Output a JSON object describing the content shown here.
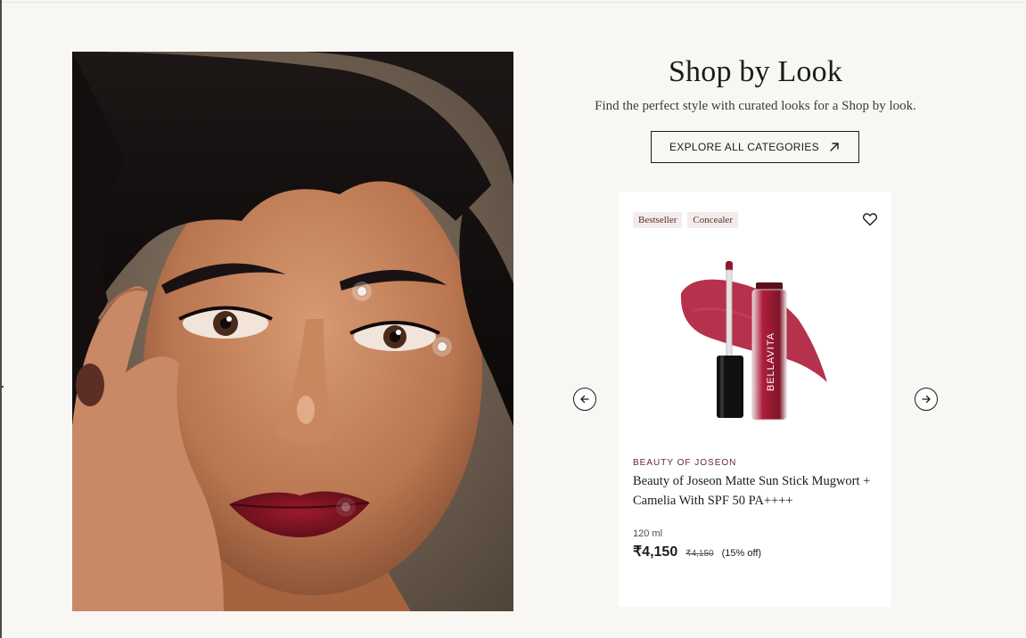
{
  "section": {
    "title": "Shop by Look",
    "subtitle": "Find the perfect style with curated looks for a Shop by look.",
    "explore_label": "EXPLORE ALL CATEGORIES"
  },
  "look": {
    "hotspot_count": 3
  },
  "carousel": {
    "product": {
      "tags": [
        "Bestseller",
        "Concealer"
      ],
      "image_brand_text": "BELLAVITA",
      "brand": "BEAUTY OF JOSEON",
      "name": "Beauty of Joseon Matte Sun Stick Mugwort + Camelia With SPF 50 PA++++",
      "volume": "120 ml",
      "price": "₹4,150",
      "mrp": "₹4,150",
      "discount": "(15% off)"
    }
  },
  "icons": {
    "explore": "arrow-up-right-icon",
    "prev": "arrow-left-icon",
    "next": "arrow-right-icon",
    "wishlist": "heart-icon"
  },
  "colors": {
    "background": "#f8f7f4",
    "card": "#ffffff",
    "tag_bg": "#f4ecec",
    "brand_accent": "#6b2733",
    "lipstick": "#b01f3c"
  }
}
